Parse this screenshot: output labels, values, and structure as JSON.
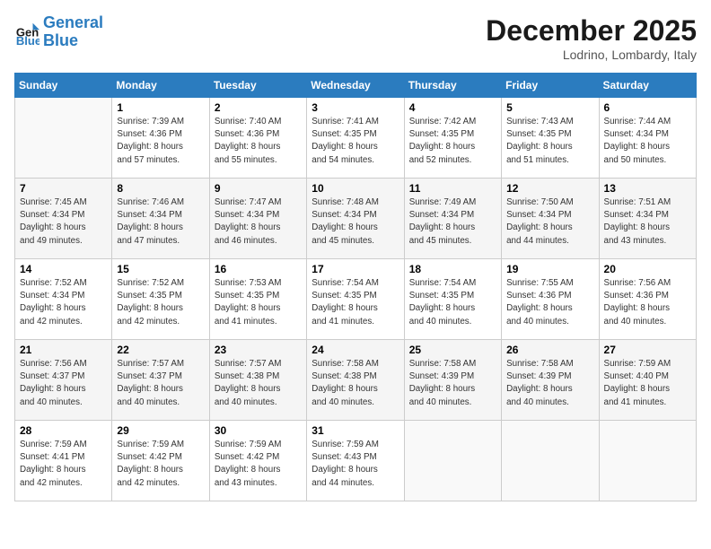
{
  "header": {
    "logo_line1": "General",
    "logo_line2": "Blue",
    "month_title": "December 2025",
    "location": "Lodrino, Lombardy, Italy"
  },
  "days_of_week": [
    "Sunday",
    "Monday",
    "Tuesday",
    "Wednesday",
    "Thursday",
    "Friday",
    "Saturday"
  ],
  "weeks": [
    [
      {
        "num": "",
        "info": ""
      },
      {
        "num": "1",
        "info": "Sunrise: 7:39 AM\nSunset: 4:36 PM\nDaylight: 8 hours\nand 57 minutes."
      },
      {
        "num": "2",
        "info": "Sunrise: 7:40 AM\nSunset: 4:36 PM\nDaylight: 8 hours\nand 55 minutes."
      },
      {
        "num": "3",
        "info": "Sunrise: 7:41 AM\nSunset: 4:35 PM\nDaylight: 8 hours\nand 54 minutes."
      },
      {
        "num": "4",
        "info": "Sunrise: 7:42 AM\nSunset: 4:35 PM\nDaylight: 8 hours\nand 52 minutes."
      },
      {
        "num": "5",
        "info": "Sunrise: 7:43 AM\nSunset: 4:35 PM\nDaylight: 8 hours\nand 51 minutes."
      },
      {
        "num": "6",
        "info": "Sunrise: 7:44 AM\nSunset: 4:34 PM\nDaylight: 8 hours\nand 50 minutes."
      }
    ],
    [
      {
        "num": "7",
        "info": "Sunrise: 7:45 AM\nSunset: 4:34 PM\nDaylight: 8 hours\nand 49 minutes."
      },
      {
        "num": "8",
        "info": "Sunrise: 7:46 AM\nSunset: 4:34 PM\nDaylight: 8 hours\nand 47 minutes."
      },
      {
        "num": "9",
        "info": "Sunrise: 7:47 AM\nSunset: 4:34 PM\nDaylight: 8 hours\nand 46 minutes."
      },
      {
        "num": "10",
        "info": "Sunrise: 7:48 AM\nSunset: 4:34 PM\nDaylight: 8 hours\nand 45 minutes."
      },
      {
        "num": "11",
        "info": "Sunrise: 7:49 AM\nSunset: 4:34 PM\nDaylight: 8 hours\nand 45 minutes."
      },
      {
        "num": "12",
        "info": "Sunrise: 7:50 AM\nSunset: 4:34 PM\nDaylight: 8 hours\nand 44 minutes."
      },
      {
        "num": "13",
        "info": "Sunrise: 7:51 AM\nSunset: 4:34 PM\nDaylight: 8 hours\nand 43 minutes."
      }
    ],
    [
      {
        "num": "14",
        "info": "Sunrise: 7:52 AM\nSunset: 4:34 PM\nDaylight: 8 hours\nand 42 minutes."
      },
      {
        "num": "15",
        "info": "Sunrise: 7:52 AM\nSunset: 4:35 PM\nDaylight: 8 hours\nand 42 minutes."
      },
      {
        "num": "16",
        "info": "Sunrise: 7:53 AM\nSunset: 4:35 PM\nDaylight: 8 hours\nand 41 minutes."
      },
      {
        "num": "17",
        "info": "Sunrise: 7:54 AM\nSunset: 4:35 PM\nDaylight: 8 hours\nand 41 minutes."
      },
      {
        "num": "18",
        "info": "Sunrise: 7:54 AM\nSunset: 4:35 PM\nDaylight: 8 hours\nand 40 minutes."
      },
      {
        "num": "19",
        "info": "Sunrise: 7:55 AM\nSunset: 4:36 PM\nDaylight: 8 hours\nand 40 minutes."
      },
      {
        "num": "20",
        "info": "Sunrise: 7:56 AM\nSunset: 4:36 PM\nDaylight: 8 hours\nand 40 minutes."
      }
    ],
    [
      {
        "num": "21",
        "info": "Sunrise: 7:56 AM\nSunset: 4:37 PM\nDaylight: 8 hours\nand 40 minutes."
      },
      {
        "num": "22",
        "info": "Sunrise: 7:57 AM\nSunset: 4:37 PM\nDaylight: 8 hours\nand 40 minutes."
      },
      {
        "num": "23",
        "info": "Sunrise: 7:57 AM\nSunset: 4:38 PM\nDaylight: 8 hours\nand 40 minutes."
      },
      {
        "num": "24",
        "info": "Sunrise: 7:58 AM\nSunset: 4:38 PM\nDaylight: 8 hours\nand 40 minutes."
      },
      {
        "num": "25",
        "info": "Sunrise: 7:58 AM\nSunset: 4:39 PM\nDaylight: 8 hours\nand 40 minutes."
      },
      {
        "num": "26",
        "info": "Sunrise: 7:58 AM\nSunset: 4:39 PM\nDaylight: 8 hours\nand 40 minutes."
      },
      {
        "num": "27",
        "info": "Sunrise: 7:59 AM\nSunset: 4:40 PM\nDaylight: 8 hours\nand 41 minutes."
      }
    ],
    [
      {
        "num": "28",
        "info": "Sunrise: 7:59 AM\nSunset: 4:41 PM\nDaylight: 8 hours\nand 42 minutes."
      },
      {
        "num": "29",
        "info": "Sunrise: 7:59 AM\nSunset: 4:42 PM\nDaylight: 8 hours\nand 42 minutes."
      },
      {
        "num": "30",
        "info": "Sunrise: 7:59 AM\nSunset: 4:42 PM\nDaylight: 8 hours\nand 43 minutes."
      },
      {
        "num": "31",
        "info": "Sunrise: 7:59 AM\nSunset: 4:43 PM\nDaylight: 8 hours\nand 44 minutes."
      },
      {
        "num": "",
        "info": ""
      },
      {
        "num": "",
        "info": ""
      },
      {
        "num": "",
        "info": ""
      }
    ]
  ]
}
